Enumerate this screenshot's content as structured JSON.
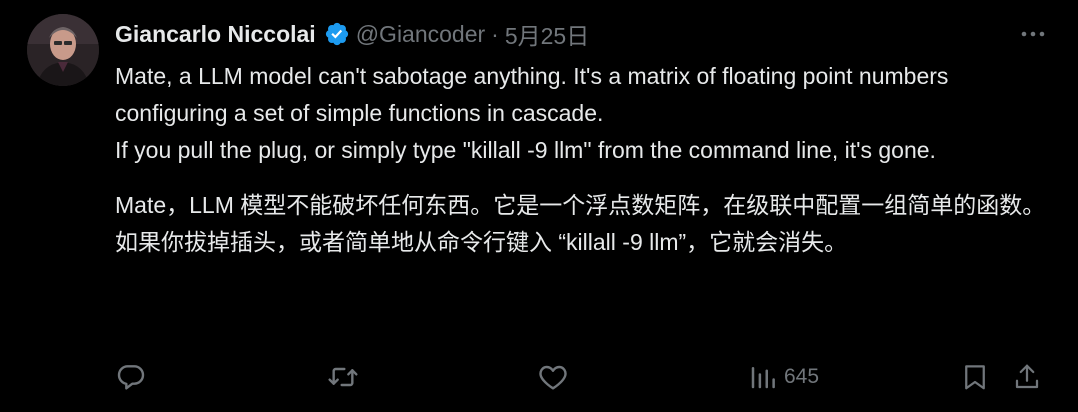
{
  "tweet": {
    "author": {
      "display_name": "Giancarlo Niccolai",
      "handle": "@Giancoder",
      "verified": true
    },
    "separator": "·",
    "timestamp": "5月25日",
    "paragraphs": [
      "Mate, a LLM model can't sabotage anything. It's a matrix of floating point numbers configuring a set of simple functions in cascade.",
      "If you pull the plug, or simply type \"killall -9 llm\" from the command line, it's gone.",
      "Mate，LLM 模型不能破坏任何东西。它是一个浮点数矩阵，在级联中配置一组简单的函数。",
      "如果你拔掉插头，或者简单地从命令行键入 “killall -9 llm”，它就会消失。"
    ],
    "actions": {
      "views": "645"
    },
    "icons": [
      "reply-icon",
      "retweet-icon",
      "like-icon",
      "views-icon",
      "bookmark-icon",
      "share-icon",
      "more-icon",
      "verified-badge-icon"
    ],
    "colors": {
      "background": "#000000",
      "text": "#e7e9ea",
      "muted": "#71767b",
      "verified": "#1d9bf0"
    }
  }
}
